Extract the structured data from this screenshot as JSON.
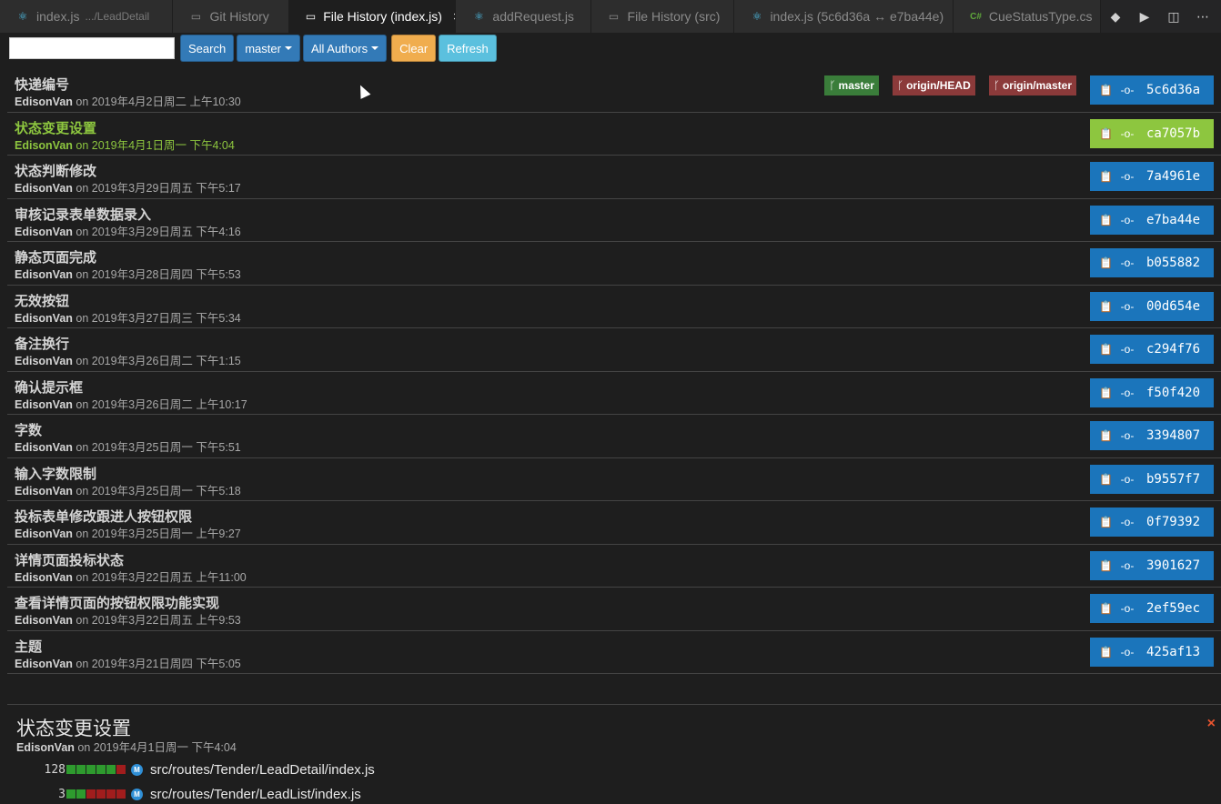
{
  "tabs": [
    {
      "icon": "react-icon",
      "label": "index.js",
      "desc": ".../LeadDetail",
      "active": false,
      "width": 193
    },
    {
      "icon": "file-icon",
      "label": "Git History",
      "desc": "",
      "active": false,
      "width": 129
    },
    {
      "icon": "file-icon",
      "label": "File History (index.js)",
      "desc": "",
      "active": true,
      "width": 186
    },
    {
      "icon": "react-icon",
      "label": "addRequest.js",
      "desc": "",
      "active": false,
      "width": 150
    },
    {
      "icon": "file-icon",
      "label": "File History (src)",
      "desc": "",
      "active": false,
      "width": 160
    },
    {
      "icon": "react-icon",
      "label": "index.js (5c6d36a ↔ e7ba44e)",
      "desc": "",
      "active": false,
      "width": 244
    },
    {
      "icon": "csharp-icon",
      "label": "CueStatusType.cs",
      "desc": "",
      "active": false,
      "width": 164
    }
  ],
  "toolbar": {
    "search_placeholder": "",
    "search_label": "Search",
    "branch_label": "master",
    "authors_label": "All Authors",
    "clear_label": "Clear",
    "refresh_label": "Refresh"
  },
  "commits": [
    {
      "message": "快递编号",
      "author": "EdisonVan",
      "date": "on 2019年4月2日周二 上午10:30",
      "hash": "5c6d36a",
      "refs": [
        {
          "name": "master",
          "color": "green"
        },
        {
          "name": "origin/HEAD",
          "color": "red"
        },
        {
          "name": "origin/master",
          "color": "red"
        }
      ]
    },
    {
      "message": "状态变更设置",
      "author": "EdisonVan",
      "date": "on 2019年4月1日周一 下午4:04",
      "hash": "ca7057b",
      "selected": true
    },
    {
      "message": "状态判断修改",
      "author": "EdisonVan",
      "date": "on 2019年3月29日周五 下午5:17",
      "hash": "7a4961e"
    },
    {
      "message": "审核记录表单数据录入",
      "author": "EdisonVan",
      "date": "on 2019年3月29日周五 下午4:16",
      "hash": "e7ba44e"
    },
    {
      "message": "静态页面完成",
      "author": "EdisonVan",
      "date": "on 2019年3月28日周四 下午5:53",
      "hash": "b055882"
    },
    {
      "message": "无效按钮",
      "author": "EdisonVan",
      "date": "on 2019年3月27日周三 下午5:34",
      "hash": "00d654e"
    },
    {
      "message": "备注换行",
      "author": "EdisonVan",
      "date": "on 2019年3月26日周二 下午1:15",
      "hash": "c294f76"
    },
    {
      "message": "确认提示框",
      "author": "EdisonVan",
      "date": "on 2019年3月26日周二 上午10:17",
      "hash": "f50f420"
    },
    {
      "message": "字数",
      "author": "EdisonVan",
      "date": "on 2019年3月25日周一 下午5:51",
      "hash": "3394807"
    },
    {
      "message": "输入字数限制",
      "author": "EdisonVan",
      "date": "on 2019年3月25日周一 下午5:18",
      "hash": "b9557f7"
    },
    {
      "message": "投标表单修改跟进人按钮权限",
      "author": "EdisonVan",
      "date": "on 2019年3月25日周一 上午9:27",
      "hash": "0f79392"
    },
    {
      "message": "详情页面投标状态",
      "author": "EdisonVan",
      "date": "on 2019年3月22日周五 上午11:00",
      "hash": "3901627"
    },
    {
      "message": "查看详情页面的按钮权限功能实现",
      "author": "EdisonVan",
      "date": "on 2019年3月22日周五 上午9:53",
      "hash": "2ef59ec"
    },
    {
      "message": "主题",
      "author": "EdisonVan",
      "date": "on 2019年3月21日周四 下午5:05",
      "hash": "425af13"
    }
  ],
  "detail": {
    "title": "状态变更设置",
    "author": "EdisonVan",
    "date": "on 2019年4月1日周一 下午4:04",
    "close": "×",
    "files": [
      {
        "count": "128",
        "bars": [
          "g",
          "g",
          "g",
          "g",
          "g",
          "r"
        ],
        "status": "M",
        "path": "src/routes/Tender/LeadDetail/index.js"
      },
      {
        "count": "3",
        "bars": [
          "g",
          "g",
          "r",
          "r",
          "r",
          "r"
        ],
        "status": "M",
        "path": "src/routes/Tender/LeadList/index.js"
      }
    ]
  }
}
